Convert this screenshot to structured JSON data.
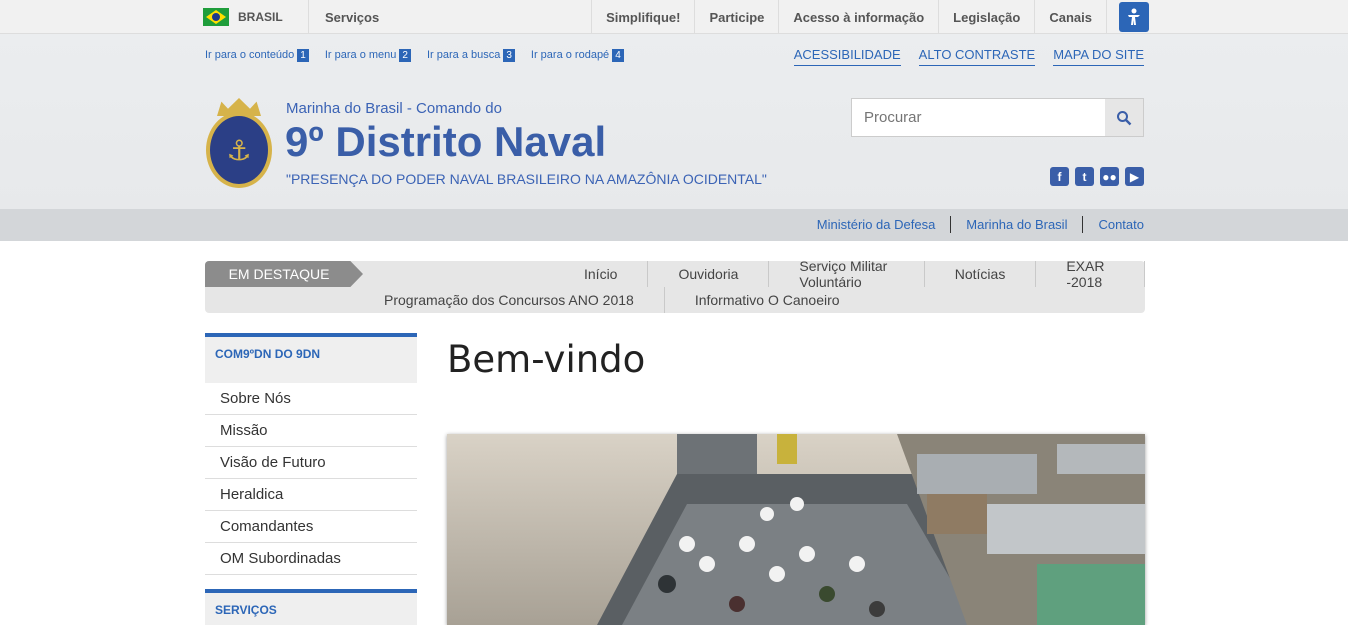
{
  "gov_bar": {
    "brasil": "BRASIL",
    "servicos": "Serviços",
    "links": [
      "Simplifique!",
      "Participe",
      "Acesso à informação",
      "Legislação",
      "Canais"
    ]
  },
  "skip_links": [
    {
      "label": "Ir para o conteúdo",
      "num": "1"
    },
    {
      "label": "Ir para o menu",
      "num": "2"
    },
    {
      "label": "Ir para a busca",
      "num": "3"
    },
    {
      "label": "Ir para o rodapé",
      "num": "4"
    }
  ],
  "accessibility_links": [
    "ACESSIBILIDADE",
    "ALTO CONTRASTE",
    "MAPA DO SITE"
  ],
  "header": {
    "pre_title": "Marinha do Brasil - Comando do",
    "title": "9º Distrito Naval",
    "slogan": "\"PRESENÇA DO PODER NAVAL BRASILEIRO NA AMAZÔNIA OCIDENTAL\""
  },
  "search": {
    "placeholder": "Procurar"
  },
  "social_icons": [
    "facebook-icon",
    "twitter-icon",
    "flickr-icon",
    "youtube-icon"
  ],
  "service_links": [
    "Ministério da Defesa",
    "Marinha do Brasil",
    "Contato"
  ],
  "nav": {
    "tag": "EM DESTAQUE",
    "row1": [
      "Início",
      "Ouvidoria",
      "Serviço Militar Voluntário",
      "Notícias",
      "EXAR -2018"
    ],
    "row2": [
      "Programação dos Concursos ANO 2018",
      "Informativo O Canoeiro"
    ]
  },
  "sidebar": {
    "section1_title": "COM9ºDN DO 9DN",
    "items": [
      "Sobre Nós",
      "Missão",
      "Visão de Futuro",
      "Heraldica",
      "Comandantes",
      "OM Subordinadas"
    ],
    "section2_title": "SERVIÇOS"
  },
  "content": {
    "heading": "Bem-vindo"
  },
  "colors": {
    "accent": "#2c66b7",
    "title": "#3a5ea8"
  }
}
